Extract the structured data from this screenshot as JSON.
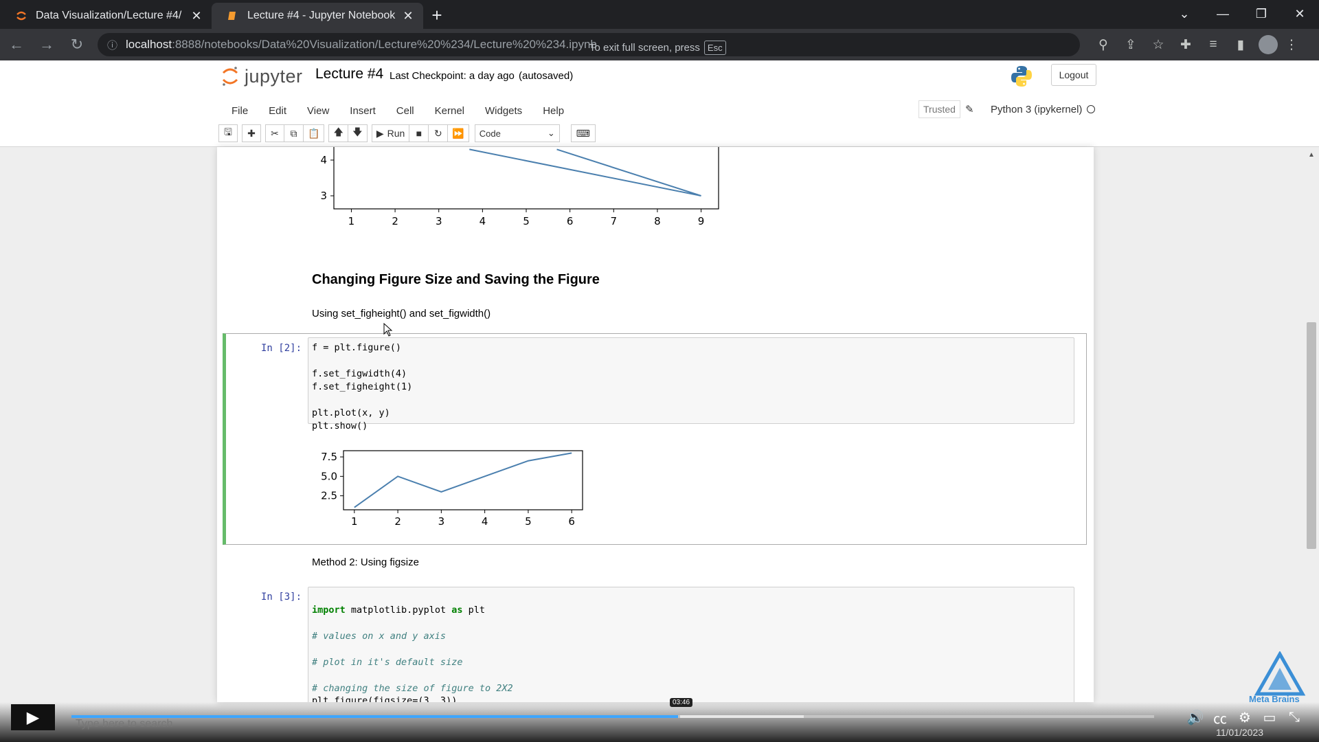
{
  "browser": {
    "tabs": [
      {
        "title": "Data Visualization/Lecture #4/"
      },
      {
        "title": "Lecture #4 - Jupyter Notebook"
      }
    ],
    "url_host": "localhost",
    "url_path": ":8888/notebooks/Data%20Visualization/Lecture%20%234/Lecture%20%234.ipynb",
    "fullscreen_note": "To exit full screen, press",
    "fullscreen_key": "Esc"
  },
  "jupyter": {
    "logo_text": "jupyter",
    "notebook_title": "Lecture #4",
    "checkpoint": "Last Checkpoint: a day ago",
    "autosave": "(autosaved)",
    "logout": "Logout",
    "menu": [
      "File",
      "Edit",
      "View",
      "Insert",
      "Cell",
      "Kernel",
      "Widgets",
      "Help"
    ],
    "trusted": "Trusted",
    "kernel": "Python 3 (ipykernel)",
    "toolbar": {
      "run_label": "Run",
      "cell_type": "Code"
    }
  },
  "notebook": {
    "heading": "Changing Figure Size and Saving the Figure",
    "para1": "Using set_figheight() and set_figwidth()",
    "cell2": {
      "prompt": "In [2]:",
      "lines": [
        "f = plt.figure()",
        "",
        "f.set_figwidth(4)",
        "f.set_figheight(1)",
        "",
        "plt.plot(x, y)",
        "plt.show()"
      ]
    },
    "para2": "Method 2: Using figsize",
    "cell3": {
      "prompt": "In [3]:",
      "import_line": {
        "kw1": "import",
        "mod": " matplotlib.pyplot ",
        "kw2": "as",
        "alias": " plt"
      },
      "comment1": "# values on x and y axis",
      "comment2": "# plot in it's default size",
      "comment3": "# changing the size of figure to 2X2",
      "line_last": "plt.figure(figsize=(3, 3))"
    }
  },
  "chart_data": [
    {
      "type": "line",
      "title": "",
      "x": [
        1,
        2,
        3,
        4,
        5,
        6,
        7,
        8,
        9
      ],
      "xlabel": "",
      "ylabel": "",
      "visible_yticks": [
        3,
        4
      ],
      "xticks": [
        "1",
        "2",
        "3",
        "4",
        "5",
        "6",
        "7",
        "8",
        "9"
      ],
      "segment_points": [
        [
          3.7,
          4.3
        ],
        [
          9,
          3
        ],
        [
          5.7,
          4.3
        ]
      ],
      "note": "partially scrolled out of view"
    },
    {
      "type": "line",
      "title": "",
      "x": [
        1,
        2,
        3,
        4,
        5,
        6
      ],
      "y": [
        1,
        5,
        3,
        5,
        7,
        8
      ],
      "yticks": [
        "2.5",
        "5.0",
        "7.5"
      ],
      "xticks": [
        "1",
        "2",
        "3",
        "4",
        "5",
        "6"
      ],
      "ylim": [
        0.7,
        8.3
      ],
      "color": "#4a7fae"
    }
  ],
  "player": {
    "timestamp": "03:46",
    "progress_fraction": 0.56,
    "watermark": "Meta Brains",
    "search_ghost": "Type here to search",
    "date_ghost": "11/01/2023"
  }
}
